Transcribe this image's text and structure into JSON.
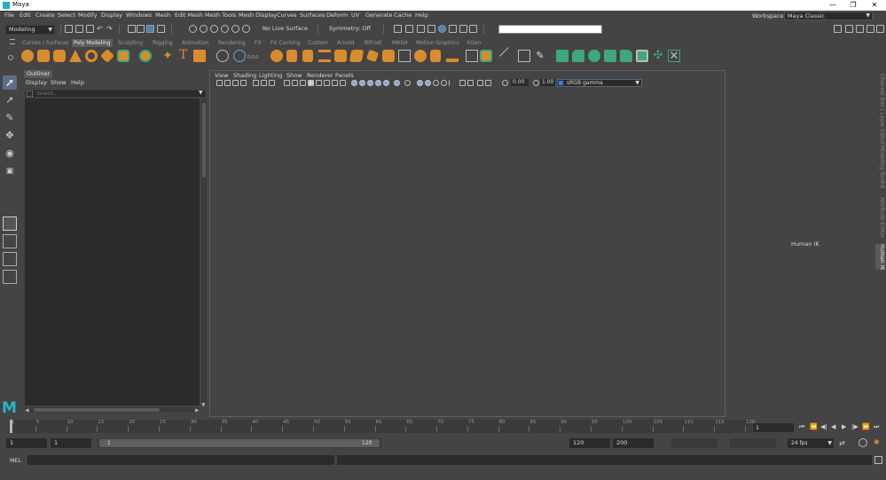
{
  "window": {
    "title": "Maya",
    "controls": [
      "—",
      "❐",
      "✕"
    ]
  },
  "menubar": {
    "items": [
      "File",
      "Edit",
      "Create",
      "Select",
      "Modify",
      "Display",
      "Windows",
      "Mesh",
      "Edit Mesh",
      "Mesh Tools",
      "Mesh Display",
      "Curves",
      "Surfaces",
      "Deform",
      "UV",
      "Generate",
      "Cache",
      "Help"
    ],
    "workspace_label": "Workspace :",
    "workspace_value": "Maya Classic"
  },
  "statusline": {
    "menuset": "Modeling",
    "live_surface": "No Live Surface",
    "symmetry": "Symmetry: Off",
    "command_field": ""
  },
  "shelf": {
    "tabs": [
      "Curves / Surfaces",
      "Poly Modeling",
      "Sculpting",
      "Rigging",
      "Animation",
      "Rendering",
      "FX",
      "FX Caching",
      "Custom",
      "Arnold",
      "Bifrost",
      "MASH",
      "Motion Graphics",
      "XGen"
    ],
    "active_tab": "Poly Modeling"
  },
  "outliner": {
    "tab": "Outliner",
    "menus": [
      "Display",
      "Show",
      "Help"
    ],
    "search_placeholder": "Search..."
  },
  "viewport": {
    "menus": [
      "View",
      "Shading",
      "Lighting",
      "Show",
      "Renderer",
      "Panels"
    ],
    "exposure": "0.00",
    "gamma": "1.00",
    "color_space": "sRGB gamma"
  },
  "right_panel": {
    "label": "Human IK",
    "tabs": [
      "Channel Box / Layer Editor",
      "Modeling Toolkit",
      "Attribute Editor",
      "Human IK"
    ],
    "active_tab": "Human IK"
  },
  "timeslider": {
    "ticks": [
      "1",
      "5",
      "10",
      "15",
      "20",
      "25",
      "30",
      "35",
      "40",
      "45",
      "50",
      "55",
      "60",
      "65",
      "70",
      "75",
      "80",
      "85",
      "90",
      "95",
      "100",
      "105",
      "110",
      "115",
      "120"
    ],
    "current_frame": "1",
    "playback_buttons": [
      "⏮",
      "⏪",
      "◀|",
      "◀",
      "▶",
      "|▶",
      "⏩",
      "⏭"
    ]
  },
  "rangeslider": {
    "start_time": "1",
    "playback_start": "1",
    "range_start_label": "1",
    "range_end_label": "120",
    "playback_end": "120",
    "end_time": "200",
    "fps": "24 fps"
  },
  "commandline": {
    "label": "MEL"
  },
  "brand": {
    "logo_letter": "M",
    "accent": "#1fb2c5",
    "shelf_orange": "#d98c2e",
    "shelf_green": "#3fa87a"
  }
}
